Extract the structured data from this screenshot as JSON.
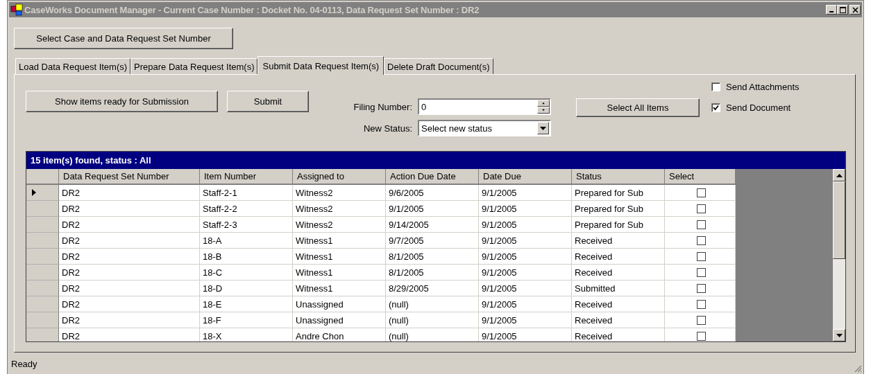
{
  "window": {
    "title": "CaseWorks Document Manager - Current Case Number : Docket No. 04-0113, Data Request Set Number : DR2"
  },
  "top_button": "Select Case and Data Request Set Number",
  "tabs": [
    {
      "label": "Load Data Request Item(s)",
      "selected": false
    },
    {
      "label": "Prepare Data Request Item(s)",
      "selected": false
    },
    {
      "label": "Submit Data Request Item(s)",
      "selected": true
    },
    {
      "label": "Delete Draft Document(s)",
      "selected": false
    }
  ],
  "actions": {
    "show_button": "Show items ready for Submission",
    "submit_button": "Submit",
    "select_all_button": "Select All Items"
  },
  "filing_number": {
    "label": "Filing Number:",
    "value": "0"
  },
  "new_status": {
    "label": "New Status:",
    "value": "Select new status"
  },
  "options": [
    {
      "label": "Send Attachments",
      "checked": false
    },
    {
      "label": "Send Document",
      "checked": true
    }
  ],
  "grid": {
    "caption": "15 item(s) found, status : All",
    "columns": [
      "Data Request Set Number",
      "Item Number",
      "Assigned to",
      "Action Due Date",
      "Date Due",
      "Status",
      "Select"
    ],
    "rows": [
      {
        "current": true,
        "cells": [
          "DR2",
          "Staff-2-1",
          "Witness2",
          "9/6/2005",
          "9/1/2005",
          "Prepared for Sub"
        ],
        "checked": false
      },
      {
        "current": false,
        "cells": [
          "DR2",
          "Staff-2-2",
          "Witness2",
          "9/1/2005",
          "9/1/2005",
          "Prepared for Sub"
        ],
        "checked": false
      },
      {
        "current": false,
        "cells": [
          "DR2",
          "Staff-2-3",
          "Witness2",
          "9/14/2005",
          "9/1/2005",
          "Prepared for Sub"
        ],
        "checked": false
      },
      {
        "current": false,
        "cells": [
          "DR2",
          "18-A",
          "Witness1",
          "9/7/2005",
          "9/1/2005",
          "Received"
        ],
        "checked": false
      },
      {
        "current": false,
        "cells": [
          "DR2",
          "18-B",
          "Witness1",
          "8/1/2005",
          "9/1/2005",
          "Received"
        ],
        "checked": false
      },
      {
        "current": false,
        "cells": [
          "DR2",
          "18-C",
          "Witness1",
          "8/1/2005",
          "9/1/2005",
          "Received"
        ],
        "checked": false
      },
      {
        "current": false,
        "cells": [
          "DR2",
          "18-D",
          "Witness1",
          "8/29/2005",
          "9/1/2005",
          "Submitted"
        ],
        "checked": false
      },
      {
        "current": false,
        "cells": [
          "DR2",
          "18-E",
          "Unassigned",
          "(null)",
          "9/1/2005",
          "Received"
        ],
        "checked": false
      },
      {
        "current": false,
        "cells": [
          "DR2",
          "18-F",
          "Unassigned",
          "(null)",
          "9/1/2005",
          "Received"
        ],
        "checked": false
      },
      {
        "current": false,
        "cells": [
          "DR2",
          "18-X",
          "Andre Chon",
          "(null)",
          "9/1/2005",
          "Received"
        ],
        "checked": false
      }
    ]
  },
  "status_bar": "Ready"
}
